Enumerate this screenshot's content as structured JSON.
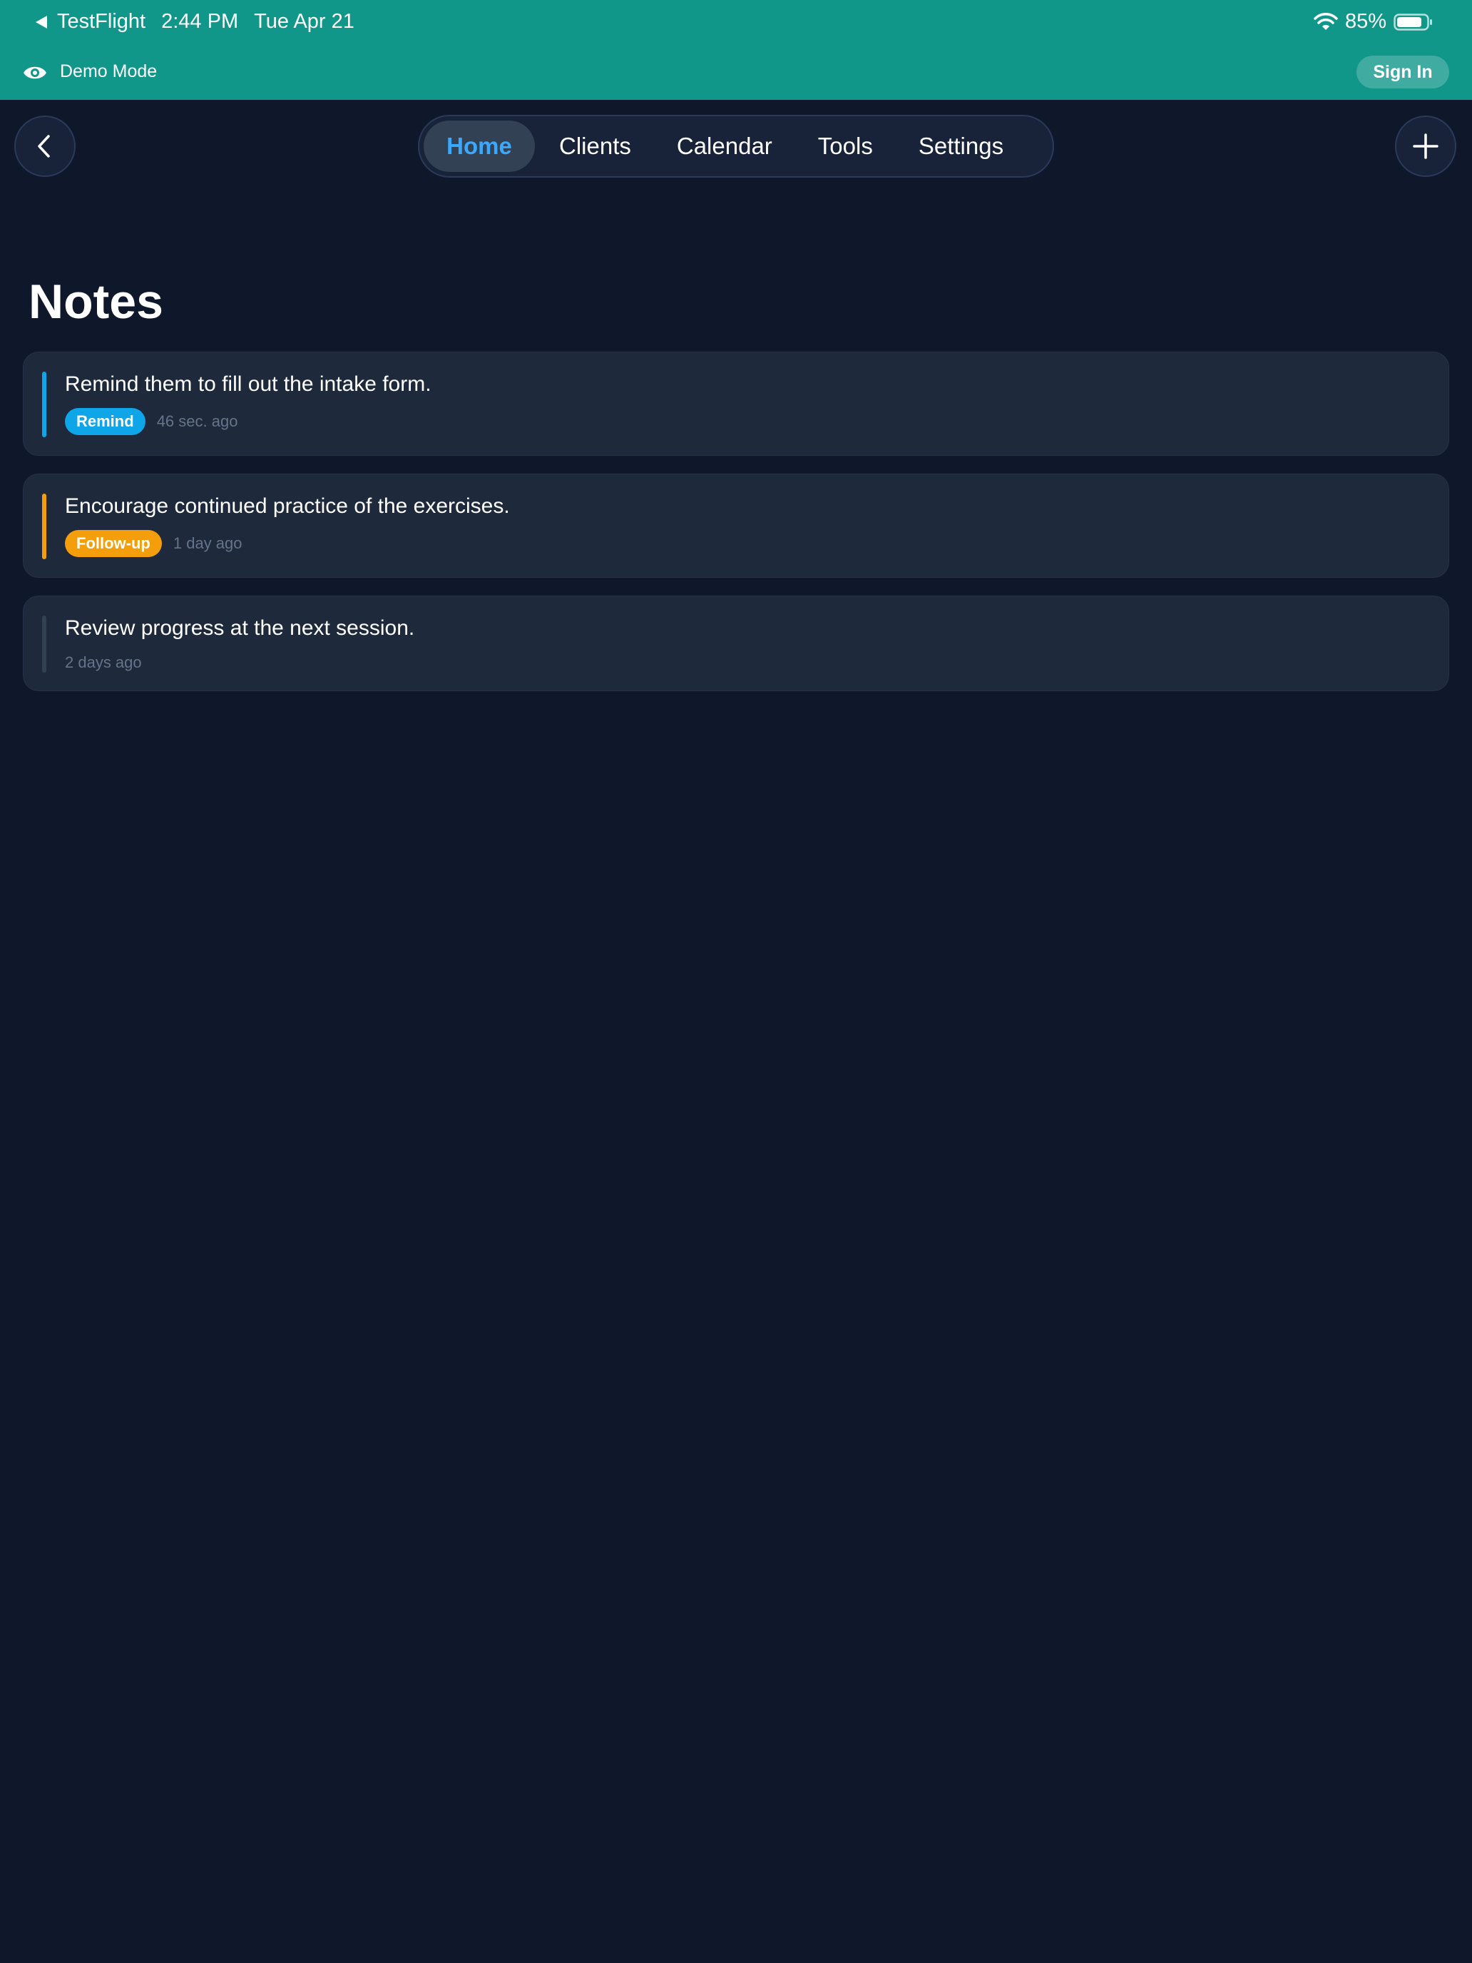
{
  "status_bar": {
    "app": "TestFlight",
    "time": "2:44 PM",
    "date": "Tue Apr 21",
    "battery": "85%",
    "battery_level": 0.85
  },
  "demo_bar": {
    "icon": "eye-icon",
    "label": "Demo Mode",
    "signin_label": "Sign In"
  },
  "toolbar": {
    "back_icon": "chevron-left-icon",
    "add_icon": "plus-icon"
  },
  "nav": {
    "tabs": [
      {
        "label": "Home",
        "active": true
      },
      {
        "label": "Clients",
        "active": false
      },
      {
        "label": "Calendar",
        "active": false
      },
      {
        "label": "Tools",
        "active": false
      },
      {
        "label": "Settings",
        "active": false
      }
    ]
  },
  "page": {
    "title": "Notes"
  },
  "notes": [
    {
      "text": "Remind them to fill out the intake form.",
      "tag": "Remind",
      "tag_color": "#0ea5e9",
      "accent_color": "#0ea5e9",
      "time": "46 sec. ago"
    },
    {
      "text": "Encourage continued practice of the exercises.",
      "tag": "Follow-up",
      "tag_color": "#f59e0b",
      "accent_color": "#f59e0b",
      "time": "1 day ago"
    },
    {
      "text": "Review progress at the next session.",
      "tag": "",
      "tag_color": "",
      "accent_color": "#334155",
      "time": "2 days ago"
    }
  ],
  "colors": {
    "header_teal": "#11968a",
    "background": "#0f172a",
    "card": "#1e293b",
    "active_tab_text": "#38a9ff"
  }
}
